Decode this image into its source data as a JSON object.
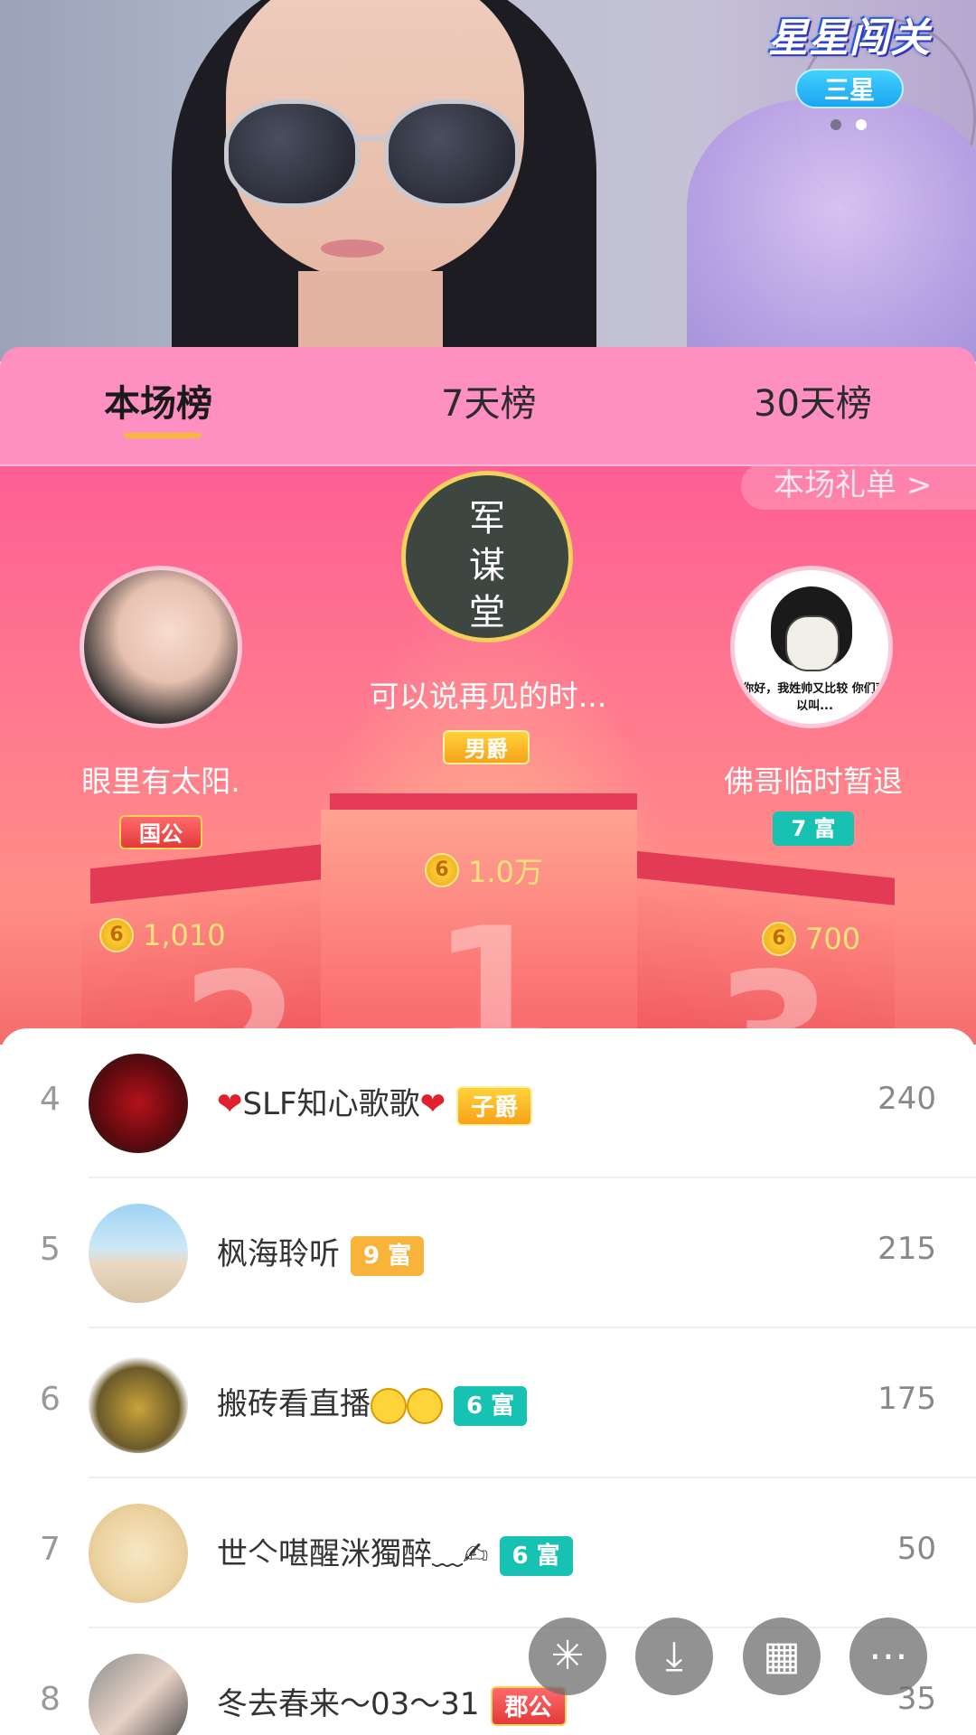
{
  "stream": {
    "game_title": "星星闯关",
    "game_level": "三星"
  },
  "tabs": [
    {
      "label": "本场榜"
    },
    {
      "label": "7天榜"
    },
    {
      "label": "30天榜"
    }
  ],
  "podium": {
    "gift_link": "本场礼单 >",
    "first": {
      "name": "可以说再见的时...",
      "badge": "男爵",
      "score": "1.0万",
      "avatar_text": "军\n谋\n堂"
    },
    "second": {
      "name": "眼里有太阳.",
      "badge": "国公",
      "score": "1,010"
    },
    "third": {
      "name": "佛哥临时暂退",
      "badge": "7 富",
      "score": "700",
      "avatar_caption": "你好，我姓帅又比较 你们可以叫..."
    }
  },
  "ranking": [
    {
      "rank": "4",
      "name": "SLF知心歌歌",
      "badge": "子爵",
      "score": "240"
    },
    {
      "rank": "5",
      "name": "枫海聆听",
      "badge": "9 富",
      "score": "215"
    },
    {
      "rank": "6",
      "name": "搬砖看直播",
      "badge": "6 富",
      "score": "175"
    },
    {
      "rank": "7",
      "name": "世亽啿醒洣獨醉﹏✍",
      "badge": "6 富",
      "score": "50"
    },
    {
      "rank": "8",
      "name": "冬去春来～03～31",
      "badge": "郡公",
      "score": "35"
    }
  ],
  "coin_symbol": "6",
  "icons": [
    "sparkle-icon",
    "download-icon",
    "grid-icon",
    "more-icon"
  ]
}
